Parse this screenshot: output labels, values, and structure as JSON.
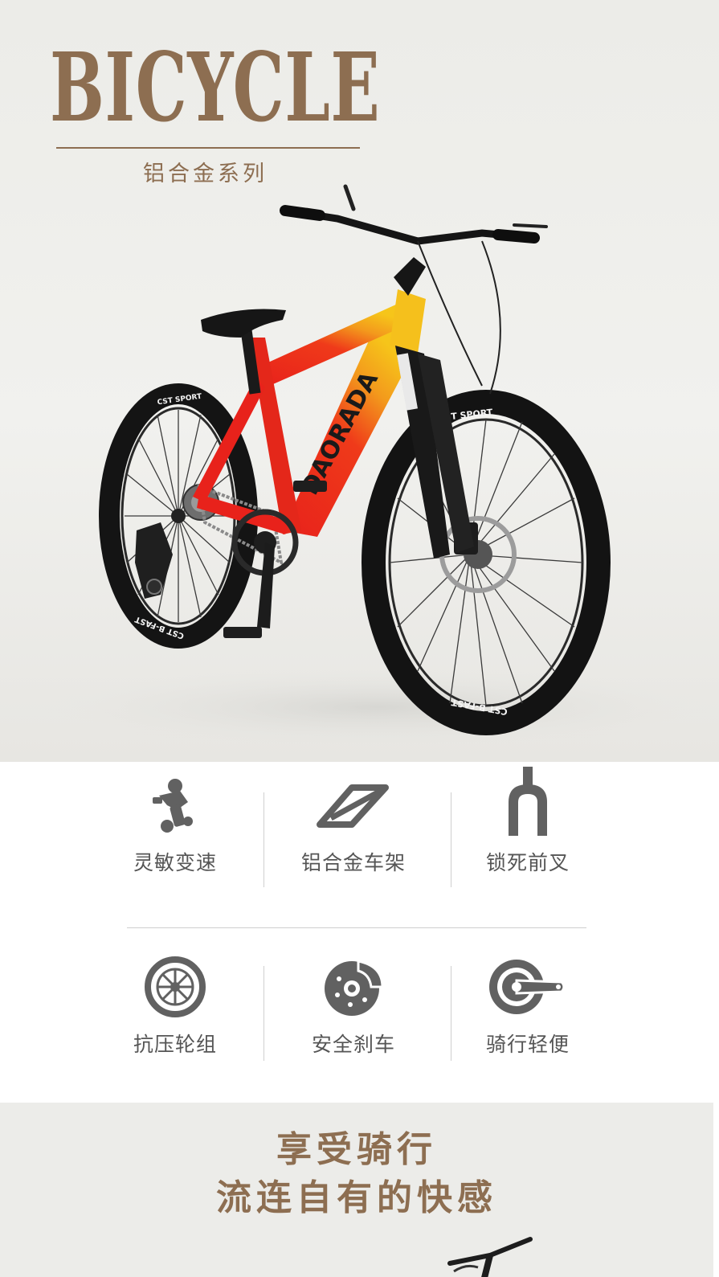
{
  "hero": {
    "title": "BICYCLE",
    "subtitle": "铝合金系列",
    "frame_logo": "DAORADA",
    "tire_brand_rear": "CST SPORT",
    "tire_brand_front": "CST SPORT",
    "tire_model_rear": "CST B-FAST",
    "tire_model_front": "CST B-FAST"
  },
  "features": {
    "items": [
      {
        "label": "灵敏变速",
        "icon": "rear-derailleur-icon"
      },
      {
        "label": "铝合金车架",
        "icon": "bike-frame-icon"
      },
      {
        "label": "锁死前叉",
        "icon": "front-fork-icon"
      },
      {
        "label": "抗压轮组",
        "icon": "wheel-icon"
      },
      {
        "label": "安全刹车",
        "icon": "disc-brake-icon"
      },
      {
        "label": "骑行轻便",
        "icon": "crankset-icon"
      }
    ]
  },
  "promo": {
    "line1": "享受骑行",
    "line2": "流连自有的快感"
  },
  "colors": {
    "accent_brown": "#8d6e51",
    "icon_gray": "#616161",
    "frame_red": "#e8221b",
    "frame_yellow": "#f6c51a"
  }
}
